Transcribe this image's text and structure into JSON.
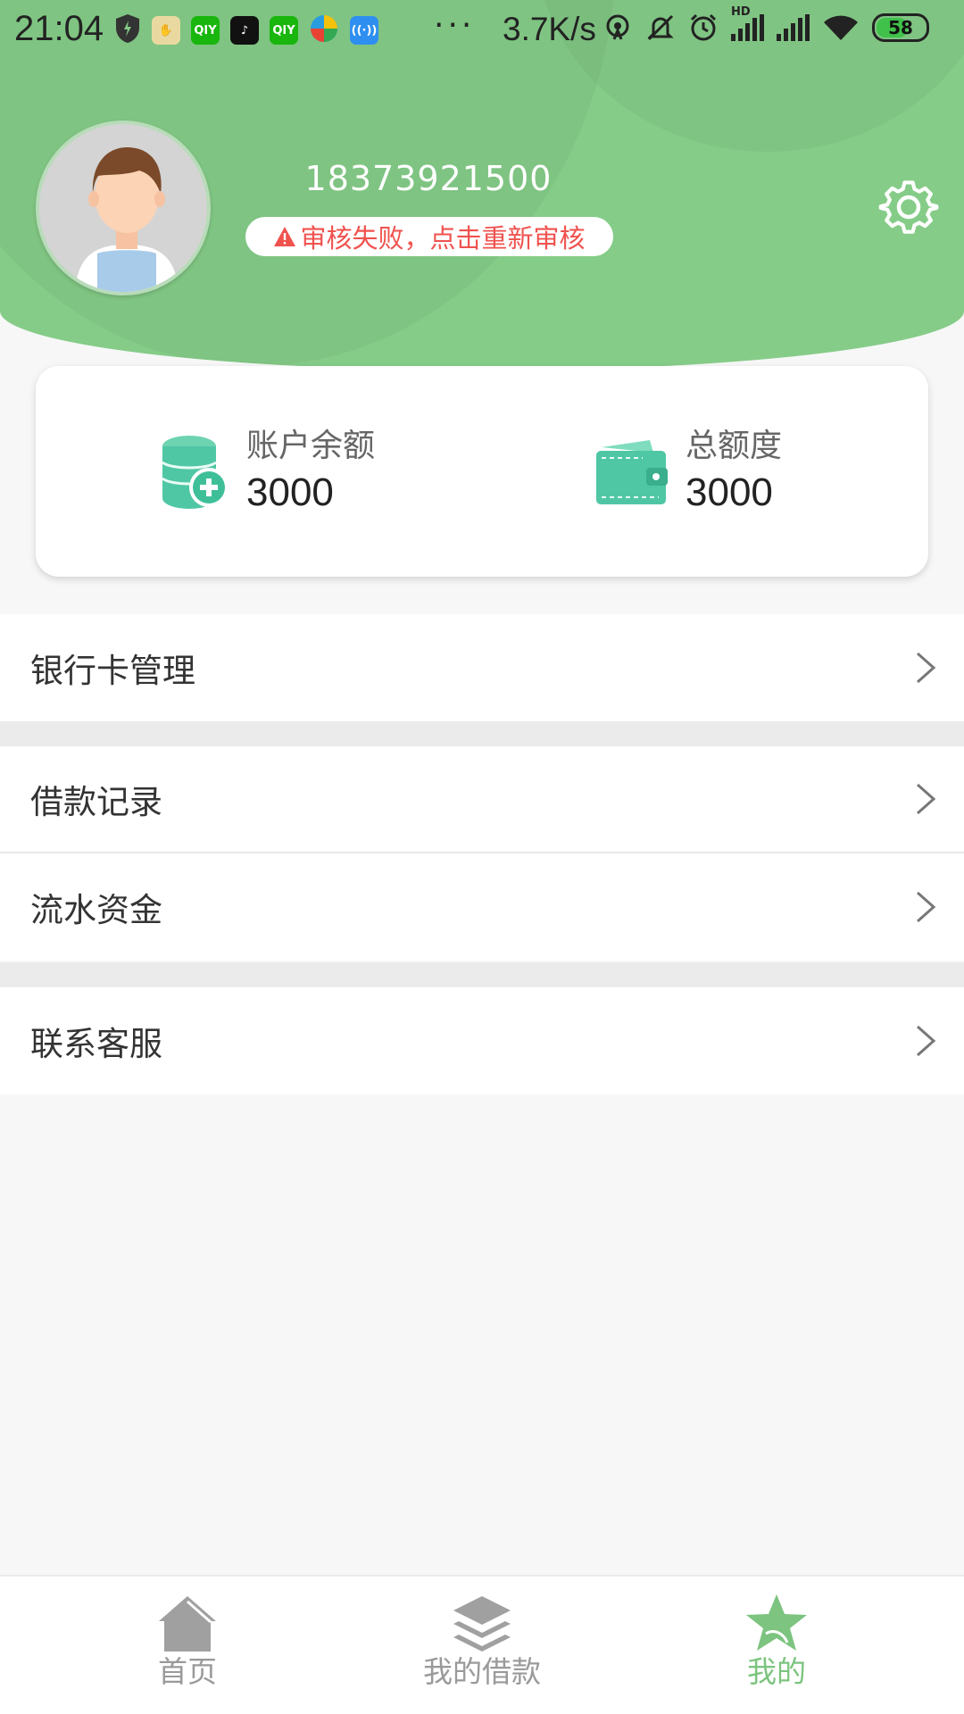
{
  "status_bar": {
    "time": "21:04",
    "more": "···",
    "net_speed": "3.7K/s",
    "battery": "58",
    "hd": "HD",
    "app_icons": [
      "shield-icon",
      "hand-icon",
      "iqiyi-icon",
      "tiktok-icon",
      "iqiyi-icon",
      "browser-icon",
      "wifi-share-icon"
    ]
  },
  "profile": {
    "phone": "18373921500",
    "audit_status": "审核失败，点击重新审核",
    "audit_color": "#f0524e"
  },
  "balance_card": {
    "balance_label": "账户余额",
    "balance_value": "3000",
    "limit_label": "总额度",
    "limit_value": "3000"
  },
  "menu": {
    "bank_card": "银行卡管理",
    "loan_records": "借款记录",
    "cash_flow": "流水资金",
    "contact_service": "联系客服"
  },
  "tabs": [
    {
      "label": "首页",
      "icon": "home-icon",
      "active": false
    },
    {
      "label": "我的借款",
      "icon": "layers-icon",
      "active": false
    },
    {
      "label": "我的",
      "icon": "star-icon",
      "active": true
    }
  ],
  "colors": {
    "brand_green": "#85cc88",
    "active_tab": "#7cc47f",
    "icon_teal": "#4fc7a5"
  }
}
